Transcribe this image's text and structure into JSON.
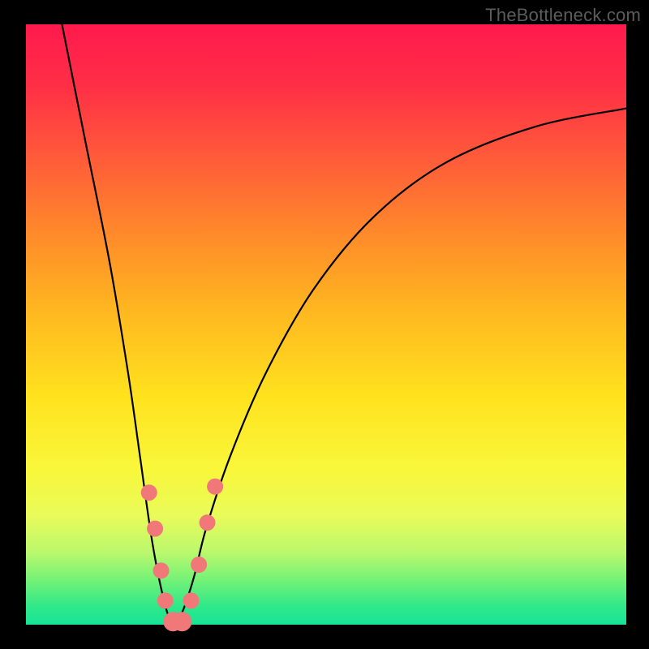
{
  "watermark": "TheBottleneck.com",
  "chart_data": {
    "type": "line",
    "title": "",
    "xlabel": "",
    "ylabel": "",
    "xlim": [
      0,
      100
    ],
    "ylim": [
      0,
      100
    ],
    "series": [
      {
        "name": "bottleneck-curve",
        "x": [
          6,
          10,
          14,
          17,
          19,
          21,
          23,
          24.5,
          26,
          28,
          30,
          34,
          40,
          48,
          58,
          70,
          85,
          100
        ],
        "values": [
          100,
          80,
          60,
          42,
          28,
          14,
          4,
          0,
          2,
          8,
          16,
          28,
          42,
          56,
          68,
          77,
          83,
          86
        ]
      }
    ],
    "markers": {
      "name": "highlighted-points",
      "color": "#f07878",
      "points": [
        {
          "x": 20.5,
          "y": 22,
          "r": 10
        },
        {
          "x": 21.5,
          "y": 16,
          "r": 10
        },
        {
          "x": 22.5,
          "y": 9,
          "r": 10
        },
        {
          "x": 23.2,
          "y": 4,
          "r": 10
        },
        {
          "x": 24.5,
          "y": 0.5,
          "r": 12
        },
        {
          "x": 26.0,
          "y": 0.5,
          "r": 12
        },
        {
          "x": 27.5,
          "y": 4,
          "r": 10
        },
        {
          "x": 28.8,
          "y": 10,
          "r": 10
        },
        {
          "x": 30.2,
          "y": 17,
          "r": 10
        },
        {
          "x": 31.5,
          "y": 23,
          "r": 10
        }
      ]
    },
    "gradient_stops": [
      {
        "pos": 0,
        "color": "#ff1a4d"
      },
      {
        "pos": 35,
        "color": "#ff8a2a"
      },
      {
        "pos": 65,
        "color": "#ffe21e"
      },
      {
        "pos": 100,
        "color": "#17e497"
      }
    ]
  }
}
